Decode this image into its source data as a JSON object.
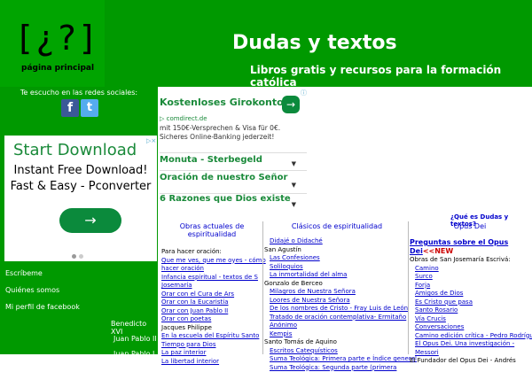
{
  "header": {
    "logo_mark": "[¿?]",
    "logo_caption": "página principal",
    "title": "Dudas y textos",
    "subtitle": "Libros gratis y recursos para la formación católica"
  },
  "sidebar": {
    "social_caption": "Te escucho en las redes sociales:",
    "facebook_glyph": "f",
    "twitter_glyph": "t",
    "links": {
      "escribeme": "Escríbeme",
      "quienes": "Quiénes somos",
      "facebook_profile": "Mi perfil de facebook",
      "benedicto": "Benedicto XVI",
      "juan_pablo": "Juan Pablo II",
      "juan_pablo_short": "Juan Pablo I"
    }
  },
  "side_ad": {
    "title": "Start Download",
    "line1": "Instant Free Download!",
    "line2": "Fast & Easy - Pconverter",
    "arrow": "→",
    "adchoice": "▷×"
  },
  "main_ad": {
    "title": "Kostenloses Girokonto",
    "arrow": "→",
    "source": "▷ comdirect.de",
    "desc": "mit 150€-Versprechen & Visa für 0€. Sicheres Online-Banking jederzeit!",
    "options": [
      "Monuta - Sterbegeld",
      "Oración de nuestro Señor",
      "6 Razones que Dios existe"
    ],
    "chevron": "▼",
    "info": "ⓘ"
  },
  "question_link": "¿Qué es Dudas y textos?",
  "columns": {
    "col1": {
      "heading": "Obras actuales de espiritualidad",
      "lines": [
        {
          "t": "t",
          "v": "Para hacer oración:"
        },
        {
          "t": "l",
          "v": "Que me ves, que me oyes - cómo"
        },
        {
          "t": "l",
          "v": "hacer oración"
        },
        {
          "t": "l",
          "v": "Infancia espiritual - textos de S"
        },
        {
          "t": "l",
          "v": "Josemaría"
        },
        {
          "t": "l",
          "v": "Orar con el Cura de Ars"
        },
        {
          "t": "l",
          "v": "Orar con la Eucaristía"
        },
        {
          "t": "l",
          "v": "Orar con Juan Pablo II"
        },
        {
          "t": "l",
          "v": "Orar con poetas"
        },
        {
          "t": "t",
          "v": "Jacques Philippe"
        },
        {
          "t": "l",
          "v": "En la escuela del Espíritu Santo"
        },
        {
          "t": "l",
          "v": "Tiempo para Dios"
        },
        {
          "t": "l",
          "v": "La paz interior"
        },
        {
          "t": "l",
          "v": "La libertad interior"
        }
      ]
    },
    "col2": {
      "heading": "Clásicos de espiritualidad",
      "lines": [
        {
          "t": "l",
          "v": "Didajé o Didaché"
        },
        {
          "t": "t",
          "v": "San Agustín"
        },
        {
          "t": "l",
          "v": "Las Confesiones"
        },
        {
          "t": "l",
          "v": "Soliloquios"
        },
        {
          "t": "l",
          "v": "La inmortalidad del alma"
        },
        {
          "t": "t",
          "v": "Gonzalo de Berceo"
        },
        {
          "t": "l",
          "v": "Milagros de Nuestra Señora"
        },
        {
          "t": "l",
          "v": "Loores de Nuestra Señora"
        },
        {
          "t": "l",
          "v": "De los nombres de Cristo - Fray Luis de León"
        },
        {
          "t": "l",
          "v": "Tratado de oración contemplativa- Ermitaño"
        },
        {
          "t": "l",
          "v": "Anónimo"
        },
        {
          "t": "l",
          "v": "Kempis"
        },
        {
          "t": "t",
          "v": "Santo Tomás de Aquino"
        },
        {
          "t": "l",
          "v": "Escritos Catequísticos"
        },
        {
          "t": "l",
          "v": "Suma Teológica: Primera parte e Índice general"
        },
        {
          "t": "l",
          "v": "Suma Teológica: Segunda parte (primera"
        }
      ]
    },
    "col3": {
      "heading": "Opus Dei",
      "first_link": "Preguntas sobre el Opus",
      "first_link2": "Dei",
      "new_tag": "<<NEW",
      "lines": [
        {
          "t": "t",
          "v": "Obras de San Josemaría Escrivá:"
        },
        {
          "t": "l",
          "v": "Camino"
        },
        {
          "t": "l",
          "v": "Surco"
        },
        {
          "t": "l",
          "v": "Forja"
        },
        {
          "t": "l",
          "v": "Amigos de Dios"
        },
        {
          "t": "l",
          "v": "Es Cristo que pasa"
        },
        {
          "t": "l",
          "v": "Santo Rosario"
        },
        {
          "t": "l",
          "v": "Vía Crucis"
        },
        {
          "t": "l",
          "v": "Conversaciones"
        },
        {
          "t": "l",
          "v": "Camino edición crítica - Pedro Rodríguez"
        },
        {
          "t": "l",
          "v": "El Opus Dei. Una investigación -"
        },
        {
          "t": "l",
          "v": "Messori"
        },
        {
          "t": "t",
          "v": "El Fundador del Opus Dei - Andrés"
        }
      ]
    }
  }
}
